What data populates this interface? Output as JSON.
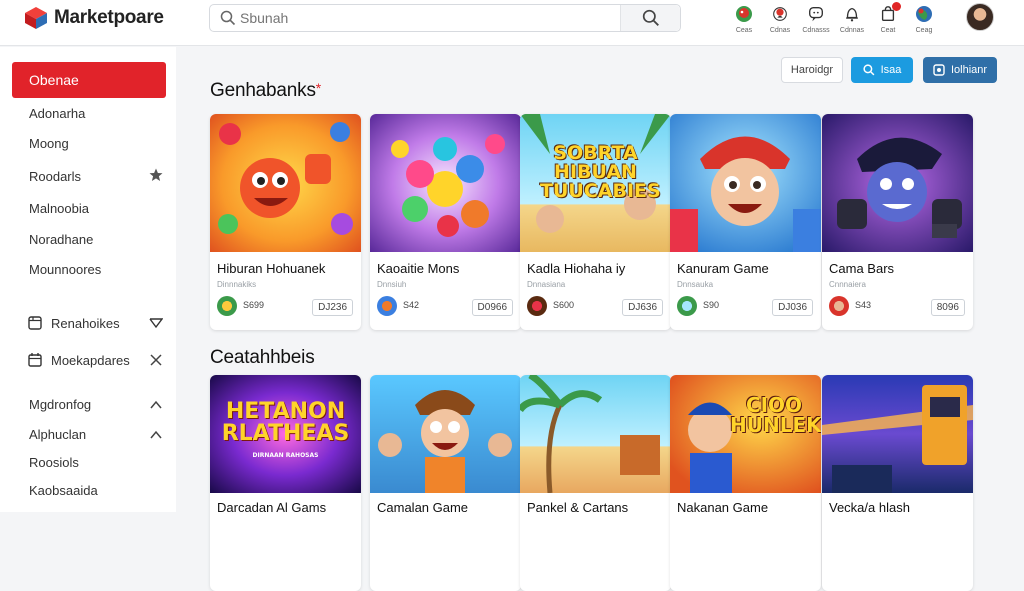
{
  "app": {
    "title": "Marketpoare"
  },
  "search": {
    "placeholder": "Sbunah"
  },
  "topbar_icons": [
    {
      "icon": "game-controller-icon",
      "caption": "Ceas"
    },
    {
      "icon": "heart-icon",
      "caption": "Cdnas"
    },
    {
      "icon": "chat-icon",
      "caption": "Cdnasss"
    },
    {
      "icon": "bell-icon",
      "caption": "Cdnnas"
    },
    {
      "icon": "cart-icon",
      "caption": "Ceat"
    },
    {
      "icon": "globe-icon",
      "caption": "Ceag"
    }
  ],
  "sidebar": {
    "primary": "Obenae",
    "items": [
      {
        "label": "Adonarha"
      },
      {
        "label": "Moong"
      },
      {
        "label": "Roodarls",
        "trail": "star-icon"
      },
      {
        "label": "Malnoobia"
      },
      {
        "label": "Noradhane"
      },
      {
        "label": "Mounnoores"
      },
      {
        "label": "Renahoikes",
        "lead": "tablet-icon",
        "trail": "chevron-down-icon"
      },
      {
        "label": "Moekapdares",
        "lead": "calendar-icon",
        "trail": "close-icon"
      },
      {
        "label": "Mgdronfog",
        "trail": "chevron-up-icon"
      },
      {
        "label": "Alphuclan",
        "trail": "chevron-up-icon"
      },
      {
        "label": "Roosiols"
      },
      {
        "label": "Kaobsaaida"
      }
    ]
  },
  "filters": {
    "sort": "Haroidgr",
    "search": "Isaa",
    "top": "Iolhianr"
  },
  "sections": [
    {
      "title": "Genhabanks",
      "cards": [
        {
          "name": "Hiburan Hohuanek",
          "sub": "Dinnnakiks",
          "score": "S699",
          "price": "DJ236",
          "art_text": ""
        },
        {
          "name": "Kaoaitie Mons",
          "sub": "Dnnsiuh",
          "score": "S42",
          "price": "D0966",
          "art_text": ""
        },
        {
          "name": "Kadla Hiohaha iy",
          "sub": "Dnnasiana",
          "score": "S600",
          "price": "DJ636",
          "art_text": "SOBRTA HIBUAN TUUCABIES"
        },
        {
          "name": "Kanuram Game",
          "sub": "Dnnsauka",
          "score": "S90",
          "price": "DJ036",
          "art_text": ""
        },
        {
          "name": "Cama Bars",
          "sub": "Cnnnaiera",
          "score": "S43",
          "price": "8096",
          "art_text": ""
        }
      ]
    },
    {
      "title": "Ceatahhbeis",
      "cards": [
        {
          "name": "Darcadan Al Gams",
          "art_text": "HETANON RLATHEAS",
          "art_sub": "DIRNAAN RAHOSAS"
        },
        {
          "name": "Camalan Game",
          "art_text": ""
        },
        {
          "name": "Pankel & Cartans",
          "art_text": ""
        },
        {
          "name": "Nakanan Game",
          "art_text": "CIOO HUNLEK"
        },
        {
          "name": "Vecka/a hlash",
          "art_text": ""
        }
      ]
    }
  ],
  "colors": {
    "accent_red": "#e1232a",
    "accent_blue": "#1c9be0",
    "dark_blue": "#2f6fa8"
  }
}
